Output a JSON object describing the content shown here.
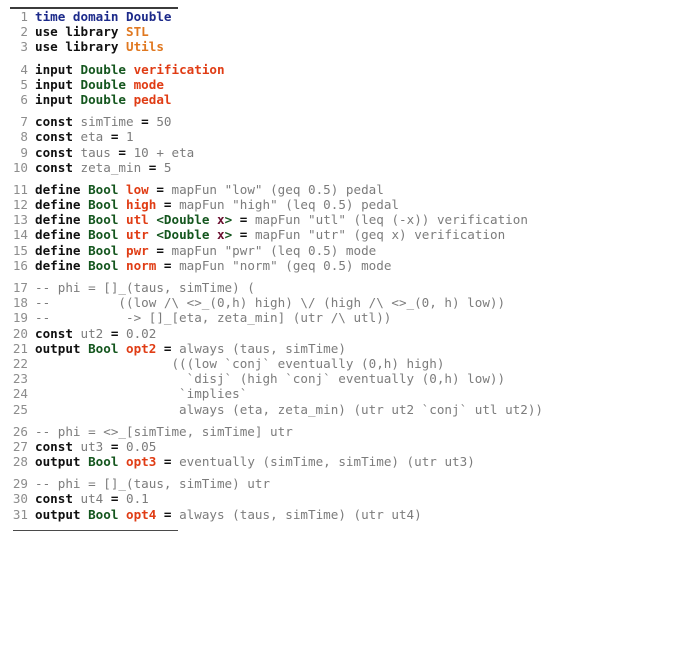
{
  "document": {
    "kind": "code-listing",
    "language": "STL specification language",
    "line_count": 31,
    "top_rule": true,
    "bottom_rule": true
  },
  "colors": {
    "background": "#ffffff",
    "line_number": "#8d8d8d",
    "plain": "#7c7c7c",
    "keyword": "#101010",
    "header_blue": "#1c2a8a",
    "library": "#e07820",
    "type": "#14561e",
    "identifier": "#e03c14",
    "type_param": "#6b1030",
    "comment": "#7c7c7c",
    "rule": "#3b3b3b"
  },
  "code": {
    "groups": [
      {
        "lines": [
          {
            "n": "1",
            "tokens": [
              {
                "t": "time domain Double",
                "c": "k-blue"
              }
            ]
          },
          {
            "n": "2",
            "tokens": [
              {
                "t": "use library ",
                "c": "k-kw"
              },
              {
                "t": "STL",
                "c": "k-lib"
              }
            ]
          },
          {
            "n": "3",
            "tokens": [
              {
                "t": "use library ",
                "c": "k-kw"
              },
              {
                "t": "Utils",
                "c": "k-lib"
              }
            ]
          }
        ]
      },
      {
        "lines": [
          {
            "n": "4",
            "tokens": [
              {
                "t": "input ",
                "c": "k-kw"
              },
              {
                "t": "Double ",
                "c": "k-type"
              },
              {
                "t": "verification",
                "c": "k-name"
              }
            ]
          },
          {
            "n": "5",
            "tokens": [
              {
                "t": "input ",
                "c": "k-kw"
              },
              {
                "t": "Double ",
                "c": "k-type"
              },
              {
                "t": "mode",
                "c": "k-name"
              }
            ]
          },
          {
            "n": "6",
            "tokens": [
              {
                "t": "input ",
                "c": "k-kw"
              },
              {
                "t": "Double ",
                "c": "k-type"
              },
              {
                "t": "pedal",
                "c": "k-name"
              }
            ]
          }
        ]
      },
      {
        "lines": [
          {
            "n": "7",
            "tokens": [
              {
                "t": "const ",
                "c": "k-kw"
              },
              {
                "t": "simTime ",
                "c": "k-var"
              },
              {
                "t": "=",
                "c": "k-op"
              },
              {
                "t": " 50",
                "c": "k-var"
              }
            ]
          },
          {
            "n": "8",
            "tokens": [
              {
                "t": "const ",
                "c": "k-kw"
              },
              {
                "t": "eta ",
                "c": "k-var"
              },
              {
                "t": "=",
                "c": "k-op"
              },
              {
                "t": " 1",
                "c": "k-var"
              }
            ]
          },
          {
            "n": "9",
            "tokens": [
              {
                "t": "const ",
                "c": "k-kw"
              },
              {
                "t": "taus ",
                "c": "k-var"
              },
              {
                "t": "=",
                "c": "k-op"
              },
              {
                "t": " 10 + eta",
                "c": "k-var"
              }
            ]
          },
          {
            "n": "10",
            "tokens": [
              {
                "t": "const ",
                "c": "k-kw"
              },
              {
                "t": "zeta_min ",
                "c": "k-var"
              },
              {
                "t": "=",
                "c": "k-op"
              },
              {
                "t": " 5",
                "c": "k-var"
              }
            ]
          }
        ]
      },
      {
        "lines": [
          {
            "n": "11",
            "tokens": [
              {
                "t": "define ",
                "c": "k-kw"
              },
              {
                "t": "Bool ",
                "c": "k-type"
              },
              {
                "t": "low ",
                "c": "k-name"
              },
              {
                "t": "=",
                "c": "k-op"
              },
              {
                "t": " mapFun \"low\" (geq 0.5) pedal",
                "c": "k-var"
              }
            ]
          },
          {
            "n": "12",
            "tokens": [
              {
                "t": "define ",
                "c": "k-kw"
              },
              {
                "t": "Bool ",
                "c": "k-type"
              },
              {
                "t": "high ",
                "c": "k-name"
              },
              {
                "t": "=",
                "c": "k-op"
              },
              {
                "t": " mapFun \"high\" (leq 0.5) pedal",
                "c": "k-var"
              }
            ]
          },
          {
            "n": "13",
            "tokens": [
              {
                "t": "define ",
                "c": "k-kw"
              },
              {
                "t": "Bool ",
                "c": "k-type"
              },
              {
                "t": "utl ",
                "c": "k-name"
              },
              {
                "t": "<Double ",
                "c": "k-type"
              },
              {
                "t": "x",
                "c": "k-tpar"
              },
              {
                "t": ">",
                "c": "k-type"
              },
              {
                "t": " ",
                "c": "k-var"
              },
              {
                "t": "=",
                "c": "k-op"
              },
              {
                "t": " mapFun \"utl\" (leq (-x)) verification",
                "c": "k-var"
              }
            ]
          },
          {
            "n": "14",
            "tokens": [
              {
                "t": "define ",
                "c": "k-kw"
              },
              {
                "t": "Bool ",
                "c": "k-type"
              },
              {
                "t": "utr ",
                "c": "k-name"
              },
              {
                "t": "<Double ",
                "c": "k-type"
              },
              {
                "t": "x",
                "c": "k-tpar"
              },
              {
                "t": ">",
                "c": "k-type"
              },
              {
                "t": " ",
                "c": "k-var"
              },
              {
                "t": "=",
                "c": "k-op"
              },
              {
                "t": " mapFun \"utr\" (geq x) verification",
                "c": "k-var"
              }
            ]
          },
          {
            "n": "15",
            "tokens": [
              {
                "t": "define ",
                "c": "k-kw"
              },
              {
                "t": "Bool ",
                "c": "k-type"
              },
              {
                "t": "pwr ",
                "c": "k-name"
              },
              {
                "t": "=",
                "c": "k-op"
              },
              {
                "t": " mapFun \"pwr\" (leq 0.5) mode",
                "c": "k-var"
              }
            ]
          },
          {
            "n": "16",
            "tokens": [
              {
                "t": "define ",
                "c": "k-kw"
              },
              {
                "t": "Bool ",
                "c": "k-type"
              },
              {
                "t": "norm ",
                "c": "k-name"
              },
              {
                "t": "=",
                "c": "k-op"
              },
              {
                "t": " mapFun \"norm\" (geq 0.5) mode",
                "c": "k-var"
              }
            ]
          }
        ]
      },
      {
        "lines": [
          {
            "n": "17",
            "tokens": [
              {
                "t": "-- phi = []_(taus, simTime) (",
                "c": "k-cmt"
              }
            ]
          },
          {
            "n": "18",
            "tokens": [
              {
                "t": "--         ((low /\\ <>_(0,h) high) \\/ (high /\\ <>_(0, h) low))",
                "c": "k-cmt"
              }
            ]
          },
          {
            "n": "19",
            "tokens": [
              {
                "t": "--          -> []_[eta, zeta_min] (utr /\\ utl))",
                "c": "k-cmt"
              }
            ]
          },
          {
            "n": "20",
            "tokens": [
              {
                "t": "const ",
                "c": "k-kw"
              },
              {
                "t": "ut2 ",
                "c": "k-var"
              },
              {
                "t": "=",
                "c": "k-op"
              },
              {
                "t": " 0.02",
                "c": "k-var"
              }
            ]
          },
          {
            "n": "21",
            "tokens": [
              {
                "t": "output ",
                "c": "k-kw"
              },
              {
                "t": "Bool ",
                "c": "k-type"
              },
              {
                "t": "opt2 ",
                "c": "k-name"
              },
              {
                "t": "=",
                "c": "k-op"
              },
              {
                "t": " always (taus, simTime)",
                "c": "k-var"
              }
            ]
          },
          {
            "n": "22",
            "tokens": [
              {
                "t": "                  (((low `conj` eventually (0,h) high)",
                "c": "k-var"
              }
            ]
          },
          {
            "n": "23",
            "tokens": [
              {
                "t": "                    `disj` (high `conj` eventually (0,h) low))",
                "c": "k-var"
              }
            ]
          },
          {
            "n": "24",
            "tokens": [
              {
                "t": "                   `implies`",
                "c": "k-var"
              }
            ]
          },
          {
            "n": "25",
            "tokens": [
              {
                "t": "                   always (eta, zeta_min) (utr ut2 `conj` utl ut2))",
                "c": "k-var"
              }
            ]
          }
        ]
      },
      {
        "lines": [
          {
            "n": "26",
            "tokens": [
              {
                "t": "-- phi = <>_[simTime, simTime] utr",
                "c": "k-cmt"
              }
            ]
          },
          {
            "n": "27",
            "tokens": [
              {
                "t": "const ",
                "c": "k-kw"
              },
              {
                "t": "ut3 ",
                "c": "k-var"
              },
              {
                "t": "=",
                "c": "k-op"
              },
              {
                "t": " 0.05",
                "c": "k-var"
              }
            ]
          },
          {
            "n": "28",
            "tokens": [
              {
                "t": "output ",
                "c": "k-kw"
              },
              {
                "t": "Bool ",
                "c": "k-type"
              },
              {
                "t": "opt3 ",
                "c": "k-name"
              },
              {
                "t": "=",
                "c": "k-op"
              },
              {
                "t": " eventually (simTime, simTime) (utr ut3)",
                "c": "k-var"
              }
            ]
          }
        ]
      },
      {
        "lines": [
          {
            "n": "29",
            "tokens": [
              {
                "t": "-- phi = []_(taus, simTime) utr",
                "c": "k-cmt"
              }
            ]
          },
          {
            "n": "30",
            "tokens": [
              {
                "t": "const ",
                "c": "k-kw"
              },
              {
                "t": "ut4 ",
                "c": "k-var"
              },
              {
                "t": "=",
                "c": "k-op"
              },
              {
                "t": " 0.1",
                "c": "k-var"
              }
            ]
          },
          {
            "n": "31",
            "tokens": [
              {
                "t": "output ",
                "c": "k-kw"
              },
              {
                "t": "Bool ",
                "c": "k-type"
              },
              {
                "t": "opt4 ",
                "c": "k-name"
              },
              {
                "t": "=",
                "c": "k-op"
              },
              {
                "t": " always (taus, simTime) (utr ut4)",
                "c": "k-var"
              }
            ]
          }
        ]
      }
    ]
  }
}
